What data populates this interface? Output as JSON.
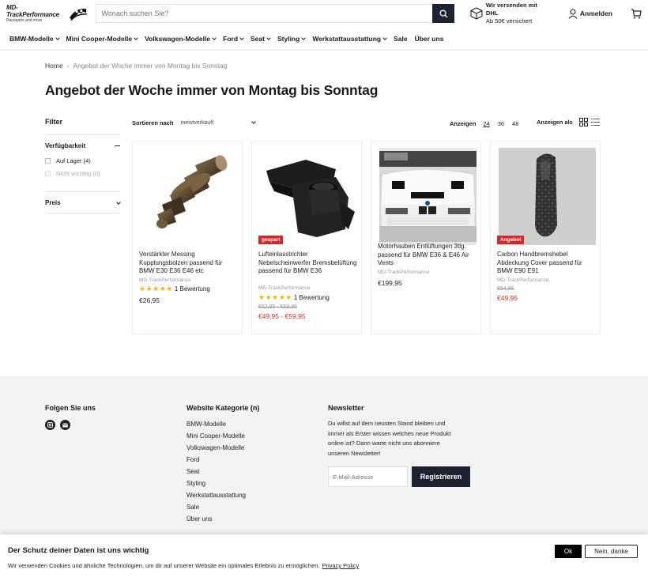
{
  "header": {
    "logo_main": "MD-TrackPerformance",
    "logo_sub": "Raceparts and more",
    "search_placeholder": "Wonach suchen Sie?",
    "ship_title": "Wir versenden mit DHL",
    "ship_sub": "Ab 50€ versichert",
    "login_label": "Anmelden"
  },
  "nav": [
    {
      "label": "BMW-Modelle",
      "dropdown": true
    },
    {
      "label": "Mini Cooper-Modelle",
      "dropdown": true
    },
    {
      "label": "Volkswagen-Modelle",
      "dropdown": true
    },
    {
      "label": "Ford",
      "dropdown": true
    },
    {
      "label": "Seat",
      "dropdown": true
    },
    {
      "label": "Styling",
      "dropdown": true
    },
    {
      "label": "Werkstattausstattung",
      "dropdown": true
    },
    {
      "label": "Sale",
      "dropdown": false
    },
    {
      "label": "Über uns",
      "dropdown": false
    }
  ],
  "breadcrumb": {
    "home": "Home",
    "separator": "›",
    "current": "Angebot der Woche immer von Montag bis Sonntag"
  },
  "page_title": "Angebot der Woche immer von Montag bis Sonntag",
  "filter": {
    "title": "Filter",
    "availability_title": "Verfügbarkeit",
    "options": [
      {
        "label": "Auf Lager (4)",
        "disabled": false
      },
      {
        "label": "Nicht vorrätig (0)",
        "disabled": true
      }
    ],
    "price_title": "Preis"
  },
  "toolbar": {
    "sort_label": "Sortieren nach",
    "sort_value": "meistverkauft",
    "show_label": "Anzeigen",
    "show_options": [
      "24",
      "36",
      "48"
    ],
    "show_active": "24",
    "view_label": "Anzeigen als"
  },
  "products": [
    {
      "name": "Verstärkter Messing Kupplungsbolzen passend für BMW E30 E36 E46 etc",
      "vendor": "MD-TrackPerformance",
      "rating_text": "1 Bewertung",
      "stars": "★★★★★",
      "price": "€26,95",
      "badge": ""
    },
    {
      "name": "Lufteinlasstrichter Nebelscheinwerfer Bremsbelüftung passend für BMW E36",
      "vendor": "MD-TrackPerformance",
      "rating_text": "1 Bewertung",
      "stars": "★★★★★",
      "was": "€52,95 - €59,95",
      "price": "€49,95 - €59,95",
      "badge": "gespart"
    },
    {
      "name": "Motorhauben Entlüftungen 3tlg. passend für BMW E36 & E46 Air Vents",
      "vendor": "MD-TrackPerformance",
      "price": "€199,95",
      "badge": ""
    },
    {
      "name": "Carbon Handbremshebel Abdeckung Cover passend für BMW E90 E91",
      "vendor": "MD-TrackPerformance",
      "was": "€54,95",
      "price": "€49,95",
      "badge": "Angebot"
    }
  ],
  "footer": {
    "social_title": "Folgen Sie uns",
    "category_title": "Website Kategorie (n)",
    "categories": [
      "BMW-Modelle",
      "Mini Cooper-Modelle",
      "Volkswagen-Modelle",
      "Ford",
      "Seat",
      "Styling",
      "Werkstattausstattung",
      "Sale",
      "Über uns"
    ],
    "newsletter_title": "Newsletter",
    "newsletter_text": "Du willst auf dem neusten Stand bleiben und immer als Erster wissen welches neue Produkt online ist? Dann warte nicht uns abonniere unseren Newsletter!",
    "email_placeholder": "E-Mail-Adresse",
    "subscribe_label": "Registrieren"
  },
  "cookie": {
    "title": "Der Schutz deiner Daten ist uns wichtig",
    "text": "Wir verwenden Cookies und ähnliche Technologien, um dir auf unserer Website ein optimales Erlebnis zu ermöglichen.",
    "policy_link": "Privacy Policy",
    "ok_label": "Ok",
    "decline_label": "Nein, danke"
  },
  "colors": {
    "dark_button": "#1c2230",
    "sale_red": "#d22a2a",
    "star_yellow": "#f3b21b",
    "footer_bg": "#f3f3f3"
  }
}
